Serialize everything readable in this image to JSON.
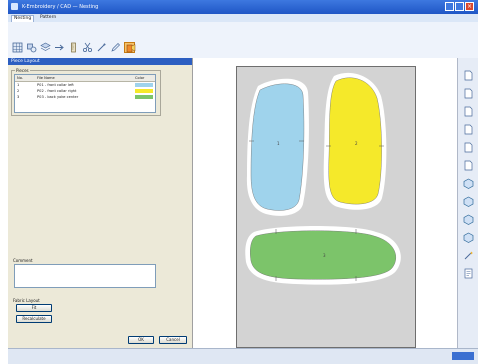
{
  "window": {
    "title": "K-Embroidery / CAD — Nesting",
    "controls": {
      "close": "×"
    }
  },
  "ribbon": {
    "tabs": [
      {
        "label": "Nesting"
      },
      {
        "label": "Pattern"
      }
    ]
  },
  "toolbar": {
    "icons": [
      "grid-icon",
      "shapes-icon",
      "layers-icon",
      "arrow-icon",
      "ruler-icon",
      "scissors-icon",
      "needle-icon",
      "pen-icon",
      "paint-icon"
    ],
    "active_index": 8
  },
  "sidebar": {
    "panel_title": "Piece Layout",
    "group_label": "Pieces",
    "list": {
      "headers": [
        "No.",
        "File Name",
        "Color"
      ],
      "rows": [
        {
          "num": "1",
          "name": "P01 - front collar left",
          "color": "#9fd3ec"
        },
        {
          "num": "2",
          "name": "P02 - front collar right",
          "color": "#f5e92a"
        },
        {
          "num": "3",
          "name": "P03 - back yoke center",
          "color": "#7cc46a"
        }
      ]
    },
    "notes_label": "Comment",
    "options_label": "Fabric Layout",
    "buttons": {
      "fit": "Fit",
      "recalc": "Recalculate",
      "ok": "OK",
      "cancel": "Cancel"
    }
  },
  "canvas": {
    "pieces": [
      {
        "label": "1",
        "color": "#9fd3ec"
      },
      {
        "label": "2",
        "color": "#f5e92a"
      },
      {
        "label": "3",
        "color": "#7cc46a"
      }
    ]
  },
  "rightbar": {
    "icons": [
      "page-icon",
      "page-icon",
      "page-icon",
      "page-icon",
      "page-icon",
      "page-icon",
      "page-icon",
      "cube-icon",
      "cube-icon",
      "cube-icon",
      "cube-icon",
      "wand-icon",
      "doc-icon"
    ]
  }
}
